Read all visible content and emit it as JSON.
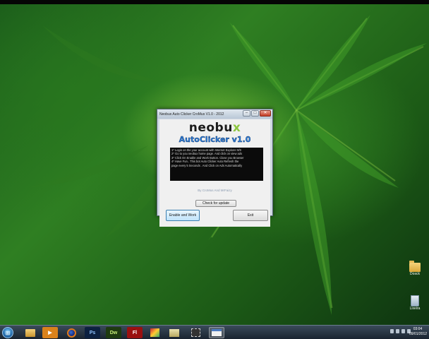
{
  "window": {
    "title": "Neobux Auto Clicker CroMus V1.0 - 2012",
    "minimize_glyph": "–",
    "maximize_glyph": "□",
    "close_glyph": "✕"
  },
  "logo": {
    "word_main": "neobu",
    "word_x": "x",
    "subtitle": "AutoClicker v1.0"
  },
  "instructions": [
    "1* Login on the your account with Internet Explorer 8/9",
    "2* Go to you neobux home page. And click on view ads",
    "3* Click On Enable and Work Button. Close you Browser",
    "4* Have Fun.. This bot Auto Clicker Auto Refresh the",
    "page every 5 Seconds . And Click on Ads Automatically"
  ],
  "byline": "By CroMus And MrFaizy",
  "buttons": {
    "update": "Check for update",
    "enable": "Enable and Work",
    "exit": "Exit"
  },
  "desktop_icons": [
    {
      "label": "Dosck",
      "icon": "folder-icon"
    },
    {
      "label": "Lixeira",
      "icon": "recycle-bin-icon"
    }
  ],
  "taskbar": {
    "items": [
      {
        "name": "explorer",
        "glyph": ""
      },
      {
        "name": "media-player",
        "glyph": "▶"
      },
      {
        "name": "firefox",
        "glyph": ""
      },
      {
        "name": "photoshop",
        "glyph": "Ps"
      },
      {
        "name": "dreamweaver",
        "glyph": "Dw"
      },
      {
        "name": "flash",
        "glyph": "Fl"
      },
      {
        "name": "image-app",
        "glyph": ""
      },
      {
        "name": "folder-app",
        "glyph": ""
      },
      {
        "name": "film-app",
        "glyph": ""
      },
      {
        "name": "window-app",
        "glyph": ""
      }
    ],
    "clock_time": "03:04",
    "clock_date": "09/01/2012"
  }
}
